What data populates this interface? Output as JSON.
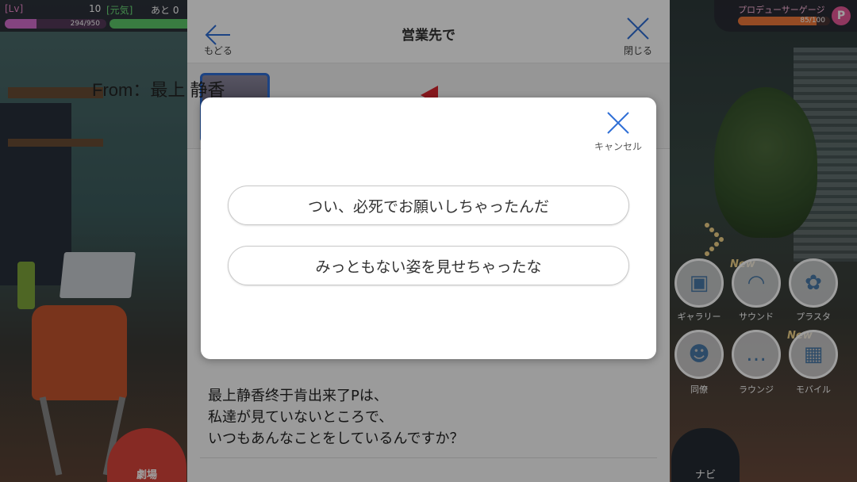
{
  "status": {
    "lv_label": "[Lv]",
    "lv_value": "10",
    "genki_label": "[元気]",
    "remain_label": "あと 0",
    "exp_text": "294/950",
    "exp_fraction": 0.31
  },
  "produce_gauge": {
    "label": "プロデューサーゲージ",
    "value_text": "85/100",
    "fraction": 0.85,
    "icon": "P"
  },
  "menu": {
    "new_tag": "New",
    "items": [
      {
        "label": "ギャラリー",
        "icon": "gallery-icon"
      },
      {
        "label": "サウンド",
        "icon": "headphones-icon"
      },
      {
        "label": "プラスタ",
        "icon": "flower-icon"
      },
      {
        "label": "同僚",
        "icon": "colleague-icon"
      },
      {
        "label": "ラウンジ",
        "icon": "chat-icon"
      },
      {
        "label": "モバイル",
        "icon": "mobile-icon"
      }
    ],
    "nav_label": "ナビ",
    "theater_label": "劇場"
  },
  "mail": {
    "back_label": "もどる",
    "title": "営業先で",
    "close_label": "閉じる",
    "from": "From：最上 静香",
    "body_lines": [
      "最上静香终于肯出来了Pは、",
      "私達が見ていないところで、",
      "いつもあんなことをしているんですか？"
    ]
  },
  "modal": {
    "cancel_label": "キャンセル",
    "choices": [
      "つい、必死でお願いしちゃったんだ",
      "みっともない姿を見せちゃったな"
    ]
  },
  "colors": {
    "accent_blue": "#2f6fd6",
    "flag_red": "#d8262e",
    "exp_pink": "#d56fcf",
    "stamina_green": "#5cc86a",
    "gauge_orange": "#f07a3a"
  }
}
